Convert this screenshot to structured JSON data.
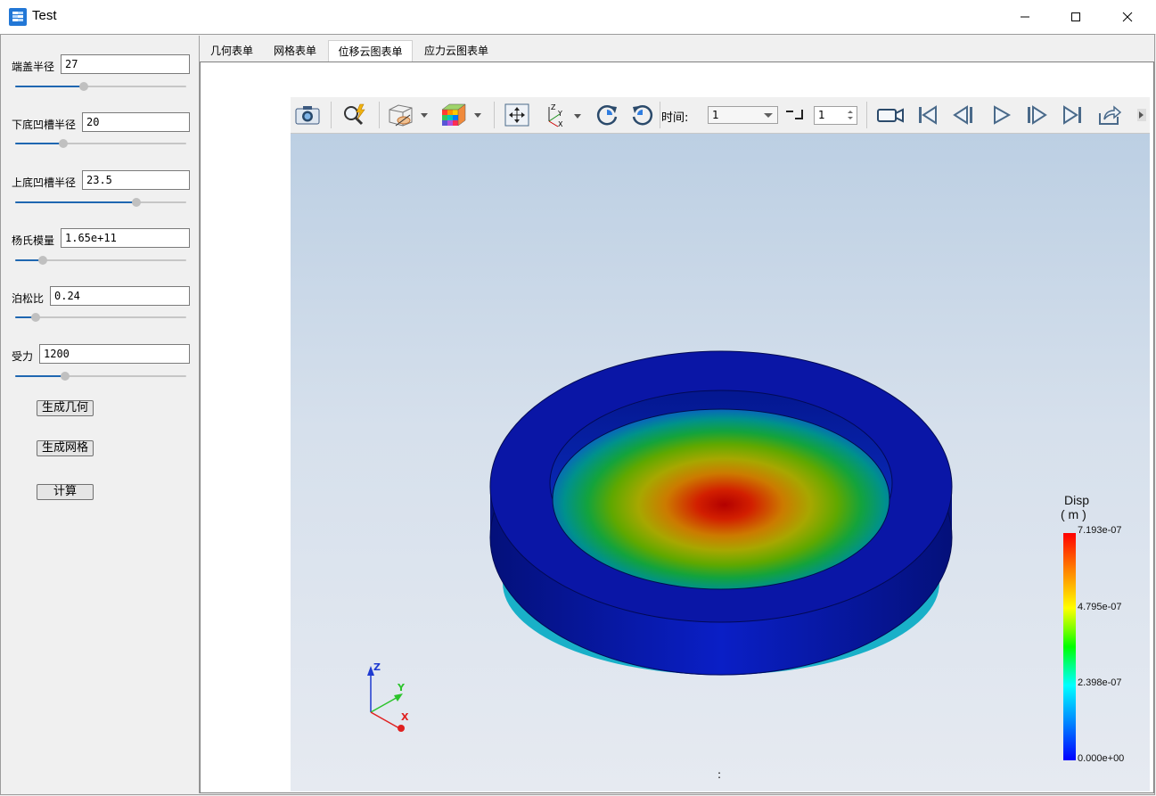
{
  "window": {
    "title": "Test"
  },
  "params": [
    {
      "label": "端盖半径",
      "value": "27",
      "slider_pct": 0.4
    },
    {
      "label": "下底凹槽半径",
      "value": "20",
      "slider_pct": 0.28
    },
    {
      "label": "上底凹槽半径",
      "value": "23.5",
      "slider_pct": 0.71
    },
    {
      "label": "杨氏模量",
      "value": "1.65e+11",
      "slider_pct": 0.16
    },
    {
      "label": "泊松比",
      "value": "0.24",
      "slider_pct": 0.12
    },
    {
      "label": "受力",
      "value": "1200",
      "slider_pct": 0.29
    }
  ],
  "buttons": {
    "geometry": "生成几何",
    "mesh": "生成网格",
    "compute": "计算"
  },
  "tabs": [
    {
      "label": "几何表单",
      "active": false
    },
    {
      "label": "网格表单",
      "active": false
    },
    {
      "label": "位移云图表单",
      "active": true
    },
    {
      "label": "应力云图表单",
      "active": false
    }
  ],
  "toolbar": {
    "time_label": "时间:",
    "time_value": "1",
    "step_value": "1",
    "icons": [
      "camera-icon",
      "zoom-tool-icon",
      "view-style-icon",
      "color-cube-icon",
      "fit-view-icon",
      "axis-orient-icon",
      "rotate-cw-icon",
      "rotate-ccw-icon",
      "record-icon",
      "first-frame-icon",
      "prev-frame-icon",
      "play-icon",
      "next-frame-icon",
      "last-frame-icon",
      "export-icon"
    ]
  },
  "legend": {
    "title_line1": "Disp",
    "title_line2": "( m )",
    "ticks": [
      "7.193e-07",
      "4.795e-07",
      "2.398e-07",
      "0.000e+00"
    ]
  },
  "axes": {
    "z": "Z",
    "y": "Y",
    "x": "X"
  },
  "colors": {
    "slider_fill": "#1f67b1",
    "mesh_outer": "#0a10a8"
  },
  "viewport": {
    "status": ":"
  }
}
